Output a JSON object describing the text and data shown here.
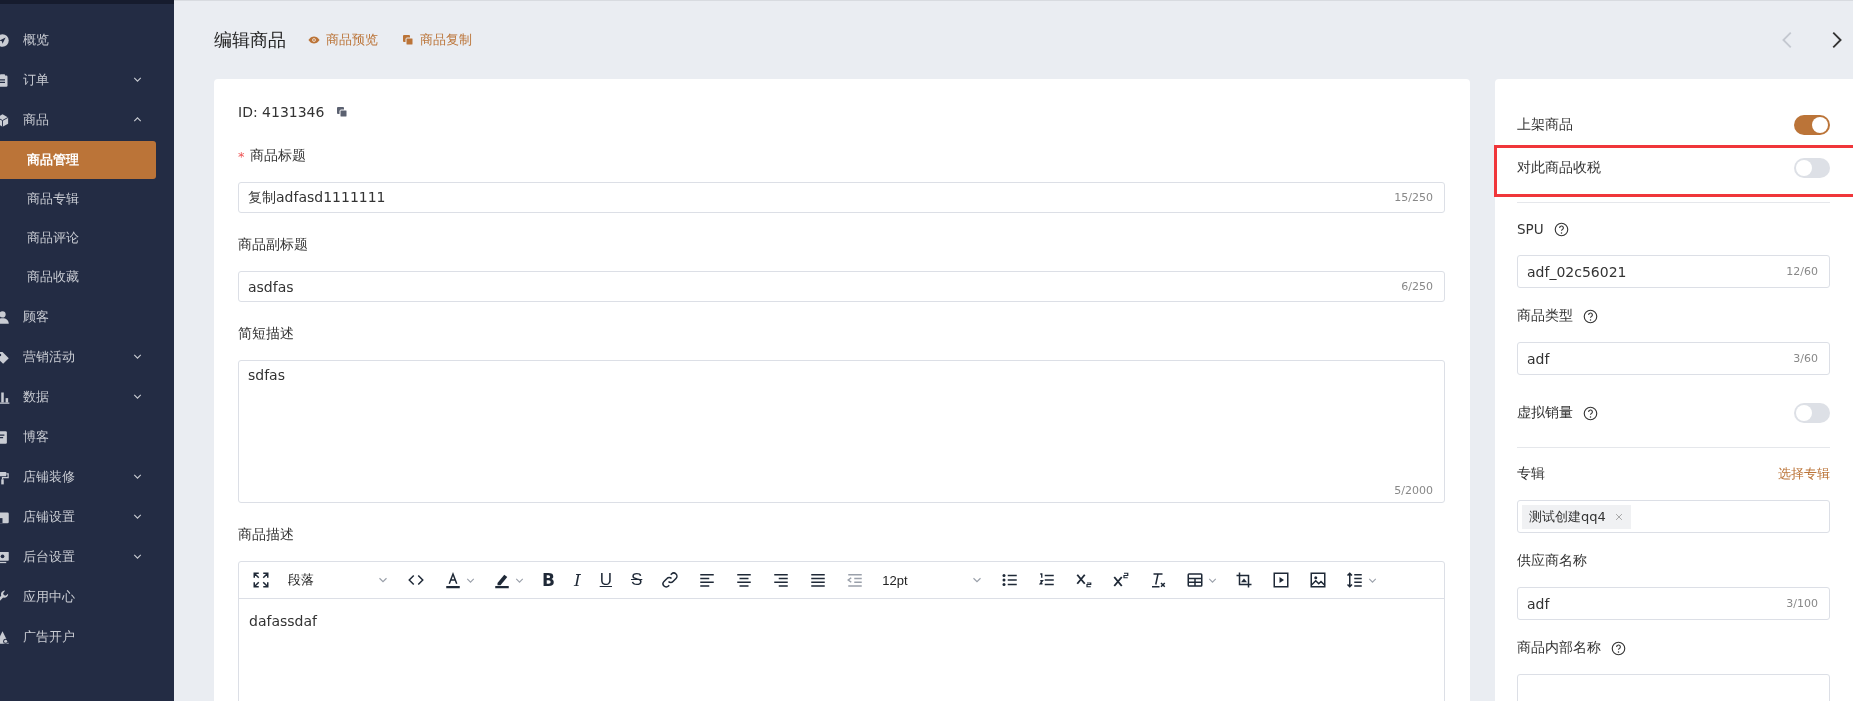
{
  "sidebar": {
    "items": [
      {
        "label": "概览"
      },
      {
        "label": "订单",
        "expanded": false
      },
      {
        "label": "商品",
        "expanded": true,
        "children": [
          {
            "label": "商品管理",
            "selected": true
          },
          {
            "label": "商品专辑",
            "selected": false
          },
          {
            "label": "商品评论",
            "selected": false
          },
          {
            "label": "商品收藏",
            "selected": false
          }
        ]
      },
      {
        "label": "顾客"
      },
      {
        "label": "营销活动",
        "expanded": false
      },
      {
        "label": "数据",
        "expanded": false
      },
      {
        "label": "博客"
      },
      {
        "label": "店铺装修",
        "expanded": false
      },
      {
        "label": "店铺设置",
        "expanded": false
      },
      {
        "label": "后台设置",
        "expanded": false
      },
      {
        "label": "应用中心"
      },
      {
        "label": "广告开户"
      }
    ]
  },
  "header": {
    "title": "编辑商品",
    "links": [
      {
        "label": "商品预览",
        "kind": "eye"
      },
      {
        "label": "商品复制",
        "kind": "copy"
      }
    ],
    "nav": [
      {
        "kind": "prev",
        "disabled": true
      },
      {
        "kind": "next",
        "disabled": false
      }
    ]
  },
  "form": {
    "id": "ID: 4131346",
    "fields": [
      {
        "kind": "input",
        "label": "商品标题",
        "required_mark": "*",
        "value": "复制adfasd1111111",
        "count": "15/250"
      },
      {
        "kind": "input",
        "label": "商品副标题",
        "value": "asdfas",
        "count": "6/250"
      },
      {
        "kind": "textarea",
        "label": "简短描述",
        "value": "sdfas",
        "count": "5/2000"
      }
    ],
    "editor": {
      "label": "商品描述",
      "selects": [
        "段落",
        "12pt"
      ],
      "format_buttons": [
        {
          "label": "B",
          "kind": "bold"
        },
        {
          "label": "I",
          "kind": "italic"
        },
        {
          "label": "U",
          "kind": "underline"
        },
        {
          "label": "S",
          "kind": "strike"
        }
      ],
      "content": "dafassdaf"
    }
  },
  "side_panel": {
    "items": [
      {
        "kind": "toggle",
        "label": "上架商品",
        "on": true,
        "highlighted": false
      },
      {
        "kind": "toggle",
        "label": "对此商品收税",
        "on": false,
        "highlighted": true
      },
      {
        "kind": "divider"
      },
      {
        "kind": "input",
        "label": "SPU",
        "help": true,
        "value": "adf_02c56021",
        "count": "12/60"
      },
      {
        "kind": "input",
        "label": "商品类型",
        "help": true,
        "value": "adf",
        "count": "3/60"
      },
      {
        "kind": "toggle",
        "label": "虚拟销量",
        "help": true,
        "on": false,
        "highlighted": false
      },
      {
        "kind": "divider"
      },
      {
        "kind": "tags",
        "label": "专辑",
        "link": "选择专辑",
        "tags": [
          "测试创建qq4"
        ]
      },
      {
        "kind": "input",
        "label": "供应商名称",
        "value": "adf",
        "count": "3/100"
      },
      {
        "kind": "input",
        "label": "商品内部名称",
        "help": true
      }
    ]
  }
}
